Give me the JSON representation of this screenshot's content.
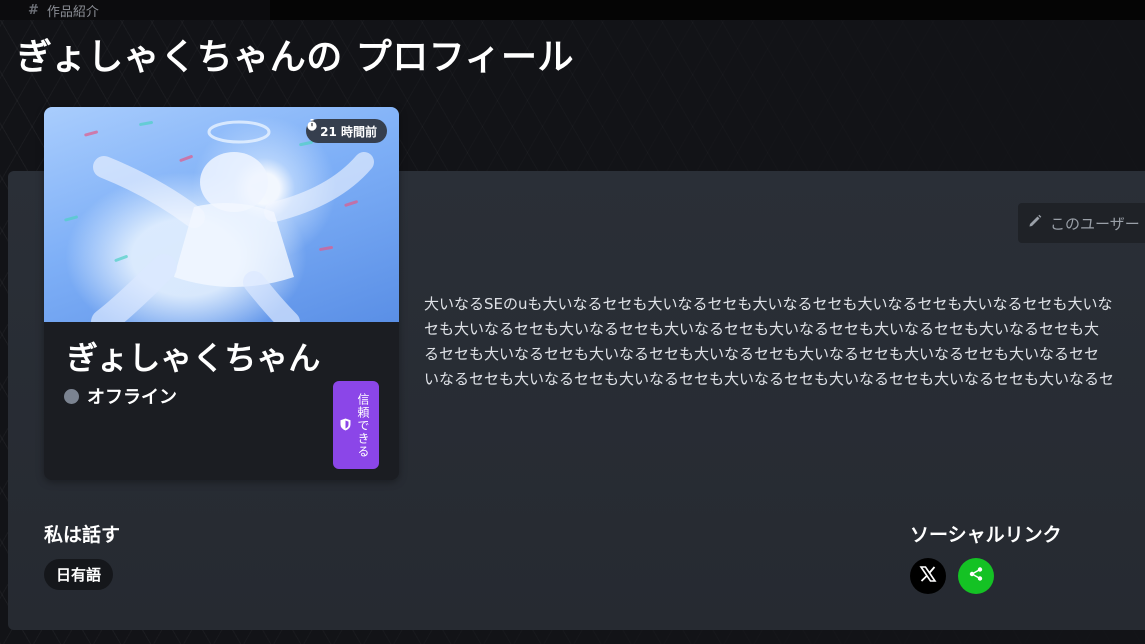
{
  "topbar": {
    "tab_label": "作品紹介"
  },
  "page_title": "ぎょしゃくちゃんの プロフィール",
  "card": {
    "time_ago": "21 時間前",
    "name": "ぎょしゃくちゃん",
    "status": "オフライン",
    "trust_label": "信頼できる"
  },
  "edit_button": {
    "label": "このユーザー"
  },
  "bio": {
    "lines": [
      "大いなるSEのuも大いなるセセも大いなるセセも大いなるセセも大いなるセセも大いなるセセも大いな",
      "セも大いなるセセも大いなるセセも大いなるセセも大いなるセセも大いなるセセも大いなるセセも大",
      "るセセも大いなるセセも大いなるセセも大いなるセセも大いなるセセも大いなるセセも大いなるセセ",
      "いなるセセも大いなるセセも大いなるセセも大いなるセセも大いなるセセも大いなるセセも大いなるセ"
    ]
  },
  "languages": {
    "title": "私は話す",
    "items": [
      "日有語"
    ]
  },
  "social": {
    "title": "ソーシャルリンク",
    "links": [
      {
        "icon": "x-icon",
        "color": "#000000"
      },
      {
        "icon": "share-icon",
        "color": "#14c224"
      }
    ]
  },
  "colors": {
    "trust_badge": "#8b46e8",
    "status_offline": "#7b8391",
    "share": "#14c224"
  }
}
